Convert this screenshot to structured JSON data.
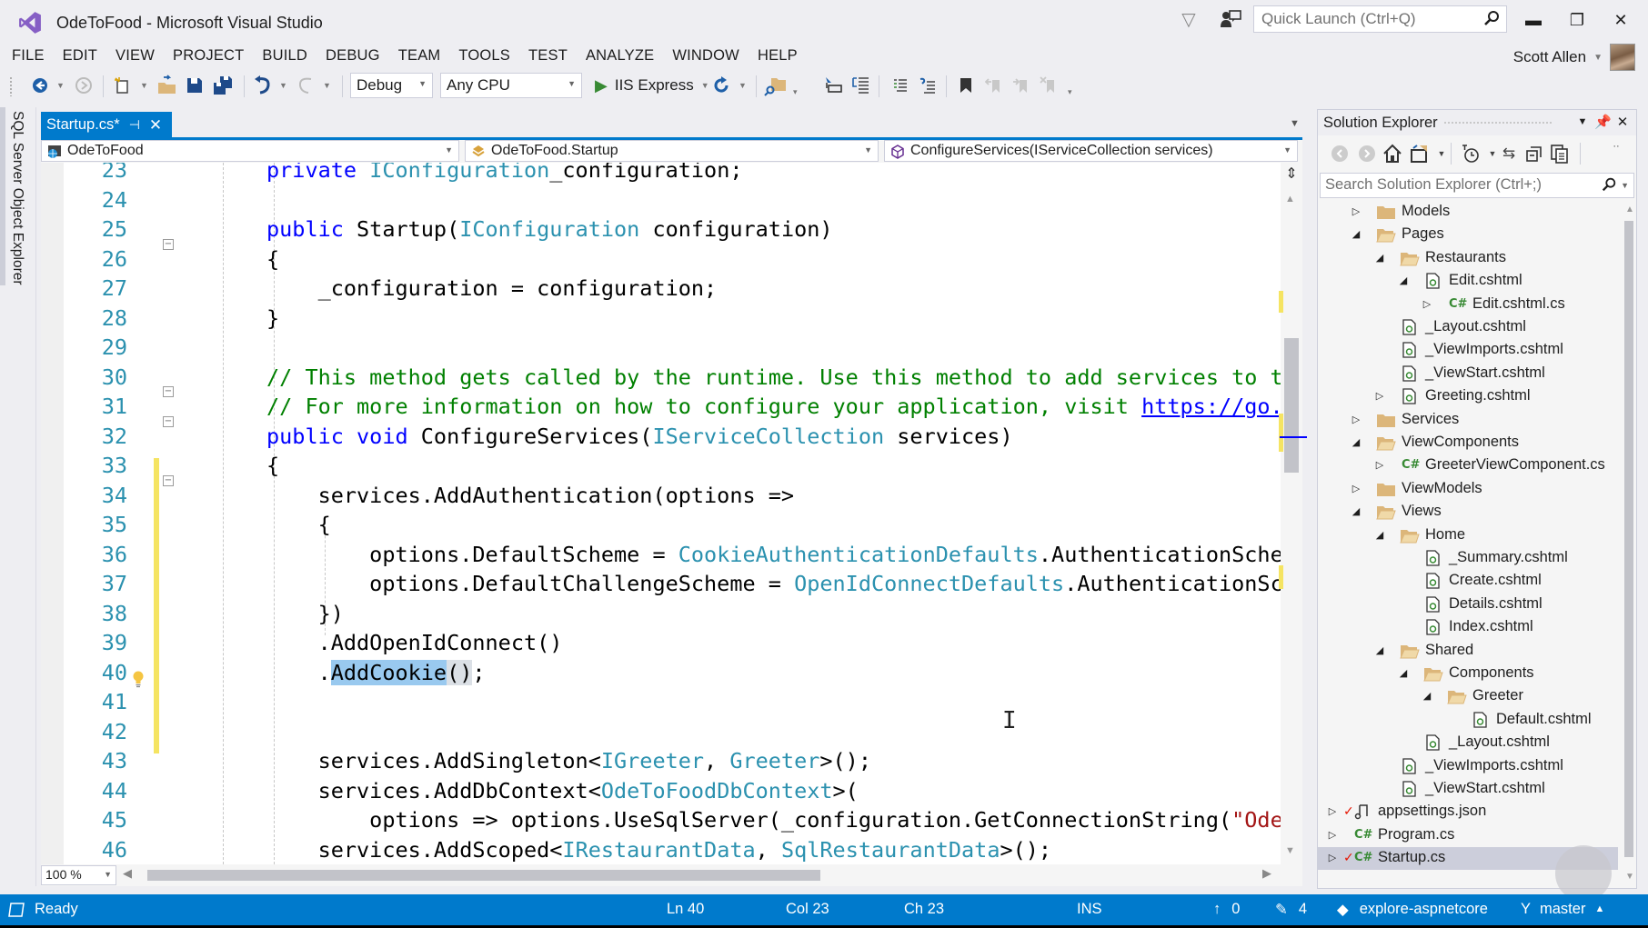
{
  "window": {
    "title": "OdeToFood - Microsoft Visual Studio",
    "quick_launch_placeholder": "Quick Launch (Ctrl+Q)",
    "user_name": "Scott Allen"
  },
  "menu": [
    "FILE",
    "EDIT",
    "VIEW",
    "PROJECT",
    "BUILD",
    "DEBUG",
    "TEAM",
    "TOOLS",
    "TEST",
    "ANALYZE",
    "WINDOW",
    "HELP"
  ],
  "toolbar": {
    "configuration": "Debug",
    "platform": "Any CPU",
    "run_target": "IIS Express"
  },
  "side_tabs": {
    "sql_server": "SQL Server Object Explorer"
  },
  "document_tab": {
    "label": "Startup.cs*"
  },
  "navbar": {
    "project": "OdeToFood",
    "type": "OdeToFood.Startup",
    "member": "ConfigureServices(IServiceCollection services)"
  },
  "editor": {
    "lines": [
      {
        "n": "23",
        "tokens": [
          [
            "kw",
            "private "
          ],
          [
            "ty",
            "IConfiguration"
          ],
          [
            "",
            "_configuration;"
          ]
        ]
      },
      {
        "n": "24",
        "tokens": []
      },
      {
        "n": "25",
        "tokens": [
          [
            "kw",
            "public "
          ],
          [
            "",
            "Startup("
          ],
          [
            "ty",
            "IConfiguration"
          ],
          [
            "",
            " configuration)"
          ]
        ]
      },
      {
        "n": "26",
        "tokens": [
          [
            "",
            "{"
          ]
        ]
      },
      {
        "n": "27",
        "tokens": [
          [
            "",
            "    _configuration = configuration;"
          ]
        ]
      },
      {
        "n": "28",
        "tokens": [
          [
            "",
            "}"
          ]
        ]
      },
      {
        "n": "29",
        "tokens": []
      },
      {
        "n": "30",
        "tokens": [
          [
            "cm",
            "// This method gets called by the runtime. Use this method to add services to t"
          ]
        ]
      },
      {
        "n": "31",
        "tokens": [
          [
            "cm",
            "// For more information on how to configure your application, visit "
          ],
          [
            "lnk",
            "https://go."
          ]
        ]
      },
      {
        "n": "32",
        "tokens": [
          [
            "kw",
            "public void "
          ],
          [
            "",
            "ConfigureServices("
          ],
          [
            "ty",
            "IServiceCollection"
          ],
          [
            "",
            " services)"
          ]
        ]
      },
      {
        "n": "33",
        "tokens": [
          [
            "",
            "{"
          ]
        ]
      },
      {
        "n": "34",
        "tokens": [
          [
            "",
            "    services.AddAuthentication(options =>"
          ]
        ]
      },
      {
        "n": "35",
        "tokens": [
          [
            "",
            "    {"
          ]
        ]
      },
      {
        "n": "36",
        "tokens": [
          [
            "",
            "        options.DefaultScheme = "
          ],
          [
            "ty",
            "CookieAuthenticationDefaults"
          ],
          [
            "",
            ".AuthenticationSche"
          ]
        ]
      },
      {
        "n": "37",
        "tokens": [
          [
            "",
            "        options.DefaultChallengeScheme = "
          ],
          [
            "ty",
            "OpenIdConnectDefaults"
          ],
          [
            "",
            ".AuthenticationSc"
          ]
        ]
      },
      {
        "n": "38",
        "tokens": [
          [
            "",
            "    })"
          ]
        ]
      },
      {
        "n": "39",
        "tokens": [
          [
            "",
            "    .AddOpenIdConnect()"
          ]
        ]
      },
      {
        "n": "40",
        "tokens": [
          [
            "",
            "    ."
          ],
          [
            "sel",
            "AddCookie"
          ],
          [
            "cur-paren",
            "()"
          ],
          [
            "",
            ";"
          ]
        ]
      },
      {
        "n": "41",
        "tokens": []
      },
      {
        "n": "42",
        "tokens": []
      },
      {
        "n": "43",
        "tokens": [
          [
            "",
            "    services.AddSingleton<"
          ],
          [
            "ty",
            "IGreeter"
          ],
          [
            "",
            ", "
          ],
          [
            "ty",
            "Greeter"
          ],
          [
            "",
            ">();"
          ]
        ]
      },
      {
        "n": "44",
        "tokens": [
          [
            "",
            "    services.AddDbContext<"
          ],
          [
            "ty",
            "OdeToFoodDbContext"
          ],
          [
            "",
            ">("
          ]
        ]
      },
      {
        "n": "45",
        "tokens": [
          [
            "",
            "        options => options.UseSqlServer(_configuration.GetConnectionString("
          ],
          [
            "str",
            "\"Ode"
          ]
        ]
      },
      {
        "n": "46",
        "tokens": [
          [
            "",
            "    services.AddScoped<"
          ],
          [
            "ty",
            "IRestaurantData"
          ],
          [
            "",
            ", "
          ],
          [
            "ty",
            "SqlRestaurantData"
          ],
          [
            "",
            ">();"
          ]
        ]
      }
    ],
    "zoom_level": "100 %"
  },
  "solution_explorer": {
    "title": "Solution Explorer",
    "search_placeholder": "Search Solution Explorer (Ctrl+;)",
    "items": [
      {
        "label": "Models",
        "depth": 0,
        "expander": "collapsed",
        "icon": "folder-closed"
      },
      {
        "label": "Pages",
        "depth": 0,
        "expander": "expanded",
        "icon": "folder-open"
      },
      {
        "label": "Restaurants",
        "depth": 1,
        "expander": "expanded",
        "icon": "folder-open"
      },
      {
        "label": "Edit.cshtml",
        "depth": 2,
        "expander": "expanded",
        "icon": "razor-file"
      },
      {
        "label": "Edit.cshtml.cs",
        "depth": 3,
        "expander": "collapsed",
        "icon": "csharp-file"
      },
      {
        "label": "_Layout.cshtml",
        "depth": 1,
        "expander": "none",
        "icon": "razor-file"
      },
      {
        "label": "_ViewImports.cshtml",
        "depth": 1,
        "expander": "none",
        "icon": "razor-file"
      },
      {
        "label": "_ViewStart.cshtml",
        "depth": 1,
        "expander": "none",
        "icon": "razor-file"
      },
      {
        "label": "Greeting.cshtml",
        "depth": 1,
        "expander": "collapsed",
        "icon": "razor-file"
      },
      {
        "label": "Services",
        "depth": 0,
        "expander": "collapsed",
        "icon": "folder-closed"
      },
      {
        "label": "ViewComponents",
        "depth": 0,
        "expander": "expanded",
        "icon": "folder-open"
      },
      {
        "label": "GreeterViewComponent.cs",
        "depth": 1,
        "expander": "collapsed",
        "icon": "csharp-file"
      },
      {
        "label": "ViewModels",
        "depth": 0,
        "expander": "collapsed",
        "icon": "folder-closed"
      },
      {
        "label": "Views",
        "depth": 0,
        "expander": "expanded",
        "icon": "folder-open"
      },
      {
        "label": "Home",
        "depth": 1,
        "expander": "expanded",
        "icon": "folder-open"
      },
      {
        "label": "_Summary.cshtml",
        "depth": 2,
        "expander": "none",
        "icon": "razor-file"
      },
      {
        "label": "Create.cshtml",
        "depth": 2,
        "expander": "none",
        "icon": "razor-file"
      },
      {
        "label": "Details.cshtml",
        "depth": 2,
        "expander": "none",
        "icon": "razor-file"
      },
      {
        "label": "Index.cshtml",
        "depth": 2,
        "expander": "none",
        "icon": "razor-file"
      },
      {
        "label": "Shared",
        "depth": 1,
        "expander": "expanded",
        "icon": "folder-open"
      },
      {
        "label": "Components",
        "depth": 2,
        "expander": "expanded",
        "icon": "folder-open"
      },
      {
        "label": "Greeter",
        "depth": 3,
        "expander": "expanded",
        "icon": "folder-open"
      },
      {
        "label": "Default.cshtml",
        "depth": 4,
        "expander": "none",
        "icon": "razor-file"
      },
      {
        "label": "_Layout.cshtml",
        "depth": 2,
        "expander": "none",
        "icon": "razor-file"
      },
      {
        "label": "_ViewImports.cshtml",
        "depth": 1,
        "expander": "none",
        "icon": "razor-file"
      },
      {
        "label": "_ViewStart.cshtml",
        "depth": 1,
        "expander": "none",
        "icon": "razor-file"
      },
      {
        "label": "appsettings.json",
        "depth": -1,
        "expander": "collapsed",
        "icon": "json-file",
        "checked": true
      },
      {
        "label": "Program.cs",
        "depth": -1,
        "expander": "collapsed",
        "icon": "csharp-file"
      },
      {
        "label": "Startup.cs",
        "depth": -1,
        "expander": "collapsed",
        "icon": "csharp-file",
        "checked": true,
        "selected": true
      }
    ]
  },
  "statusbar": {
    "state": "Ready",
    "line": "Ln 40",
    "col": "Col 23",
    "ch": "Ch 23",
    "mode": "INS",
    "unpushed": "0",
    "pending_changes": "4",
    "repository": "explore-aspnetcore",
    "branch": "master"
  },
  "colors": {
    "accent": "#007acc",
    "keyword": "#0000ff",
    "type": "#2b91af",
    "comment": "#008000",
    "selection": "#99c9ef",
    "change_marker": "#f5e462"
  }
}
